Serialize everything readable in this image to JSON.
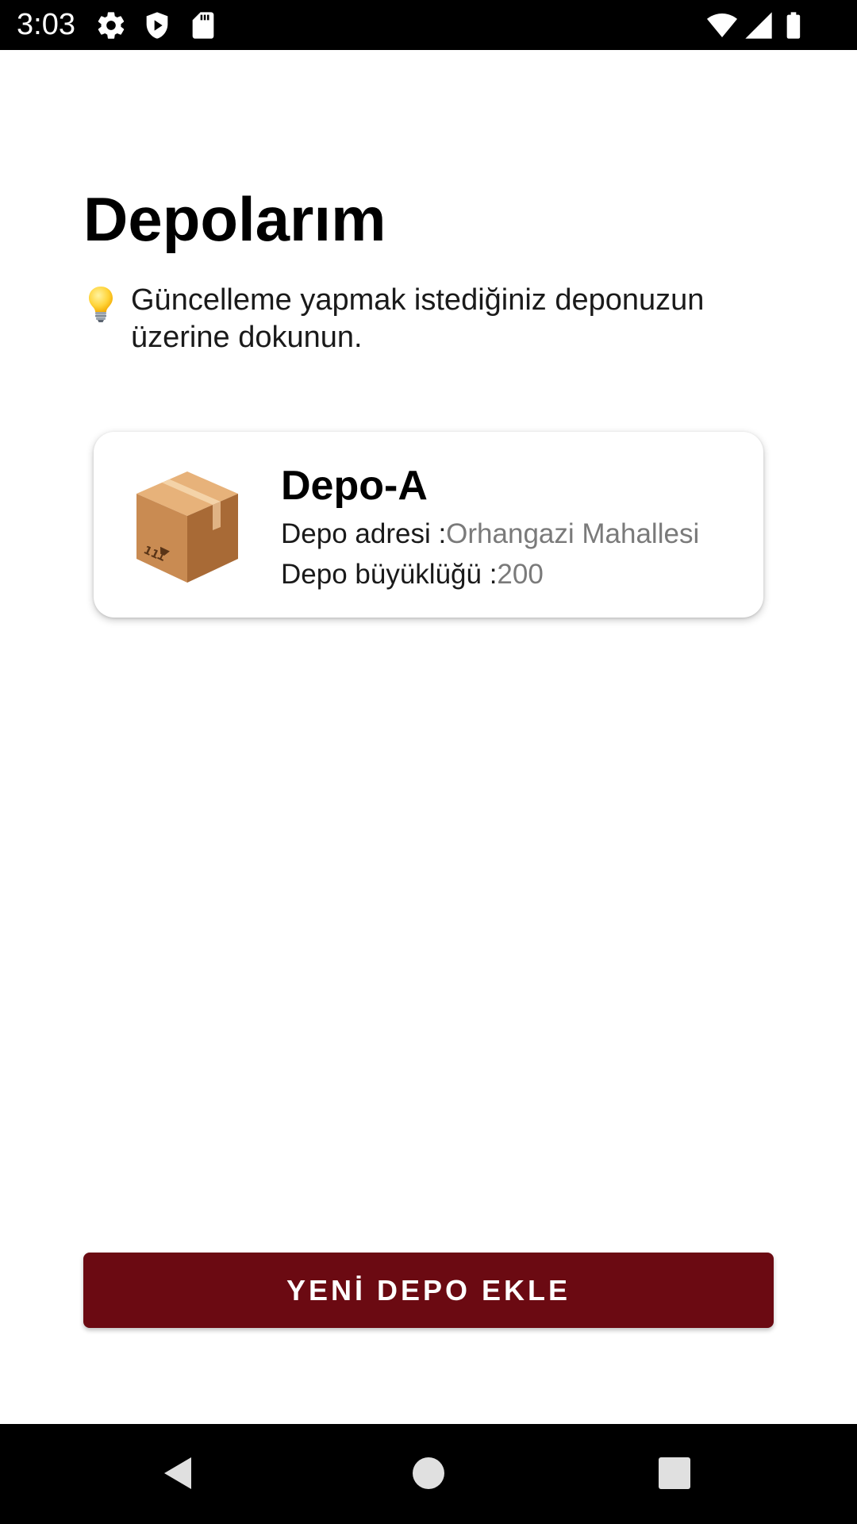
{
  "status_bar": {
    "time": "3:03",
    "left_icons": [
      "gear-icon",
      "shield-play-icon",
      "sd-card-icon"
    ],
    "right_icons": [
      "wifi-icon",
      "cell-signal-icon",
      "battery-icon"
    ]
  },
  "page": {
    "title": "Depolarım",
    "hint_icon": "lightbulb-icon",
    "hint_text": "Güncelleme yapmak istediğiniz deponuzun üzerine dokunun."
  },
  "depots": [
    {
      "icon": "package-box-icon",
      "name": "Depo-A",
      "address_label": "Depo adresi :",
      "address_value": "Orhangazi Mahallesi",
      "size_label": "Depo büyüklüğü :",
      "size_value": "200"
    }
  ],
  "actions": {
    "add_depot_label": "YENİ DEPO EKLE"
  },
  "colors": {
    "primary_button": "#6b0a12",
    "value_text": "#7a7a7a",
    "system_bars": "#000000"
  },
  "nav_bar": {
    "buttons": [
      "back-icon",
      "home-icon",
      "recents-icon"
    ]
  }
}
